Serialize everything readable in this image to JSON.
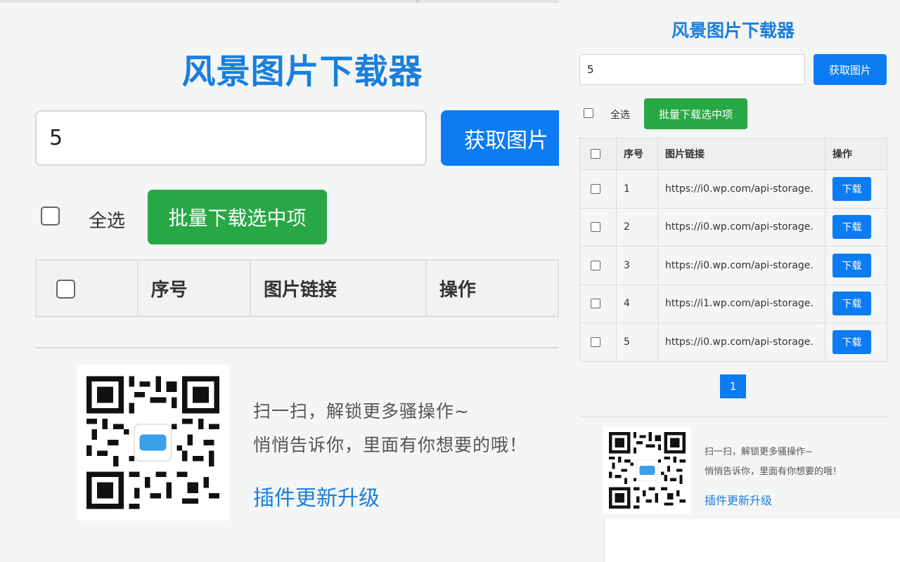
{
  "app": {
    "title": "风景图片下载器"
  },
  "search": {
    "value": "5",
    "fetch_label": "获取图片"
  },
  "toolbar": {
    "select_all_label": "全选",
    "batch_download_label": "批量下载选中项"
  },
  "table": {
    "headers": [
      "",
      "序号",
      "图片链接",
      "操作"
    ],
    "rows": [
      {
        "index": "1",
        "url": "https://i0.wp.com/api-storage.",
        "action": "下载"
      },
      {
        "index": "2",
        "url": "https://i0.wp.com/api-storage.",
        "action": "下载"
      },
      {
        "index": "3",
        "url": "https://i0.wp.com/api-storage.",
        "action": "下载"
      },
      {
        "index": "4",
        "url": "https://i1.wp.com/api-storage.",
        "action": "下载"
      },
      {
        "index": "5",
        "url": "https://i0.wp.com/api-storage.",
        "action": "下载"
      }
    ]
  },
  "pagination": {
    "current_page": "1"
  },
  "promo": {
    "line1": "扫一扫，解锁更多骚操作~",
    "line2": "悄悄告诉你，里面有你想要的哦！",
    "upgrade_link": "插件更新升级"
  },
  "colors": {
    "accent_blue": "#0d7cf2",
    "title_blue": "#1a7fdd",
    "success_green": "#28a745",
    "background": "#f4f5f5"
  },
  "icons": {
    "qr_code": "qr-code-icon",
    "checkbox": "checkbox-icon"
  }
}
